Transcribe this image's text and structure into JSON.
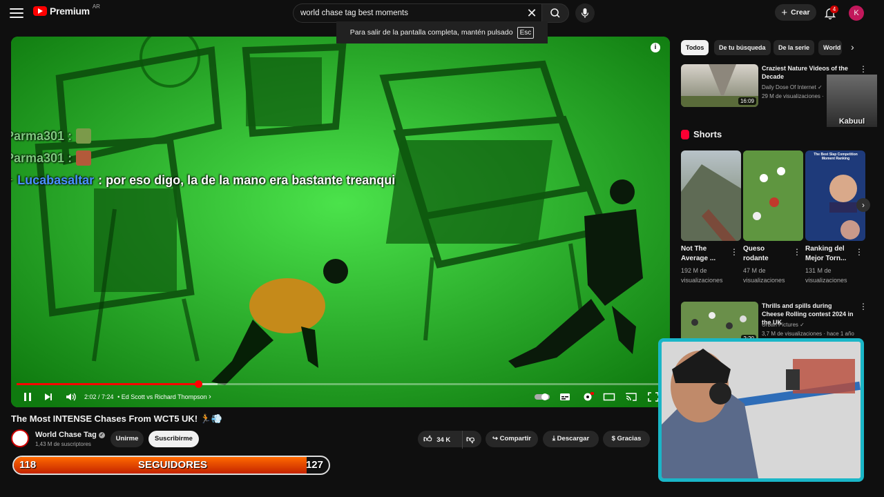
{
  "header": {
    "logo_text": "Premium",
    "logo_country": "AR",
    "search_value": "world chase tag best moments",
    "create_label": "Crear",
    "notification_count": "4",
    "avatar_letter": "K"
  },
  "fullscreen_toast": {
    "text": "Para salir de la pantalla completa, mantén pulsado",
    "key": "Esc"
  },
  "player": {
    "chat": [
      {
        "user": "Parma301 :",
        "message": ""
      },
      {
        "user": "Parma301 :",
        "message": ""
      },
      {
        "user": "Lucabasaltar",
        "message": ": por eso digo, la de la mano era bastante treanqui"
      }
    ],
    "time_display": "2:02 / 7:24",
    "chapter": "• Ed Scott vs Richard Thompson",
    "progress_fraction": 0.28,
    "buffer_fraction": 0.31
  },
  "video": {
    "title": "The Most INTENSE Chases From WCT5 UK! 🏃💨",
    "channel_name": "World Chase Tag",
    "subscribers": "1,43 M de suscriptores",
    "join_label": "Unirme",
    "subscribe_label": "Suscribirme",
    "likes": "34 K",
    "share_label": "Compartir",
    "download_label": "Descargar",
    "thanks_label": "Gracias"
  },
  "followers_goal": {
    "current": "118",
    "label": "SEGUIDORES",
    "target": "127",
    "fraction": 0.929
  },
  "sidebar": {
    "chips": [
      "Todos",
      "De tu búsqueda",
      "De la serie",
      "World"
    ],
    "recommended": [
      {
        "title": "Craziest Nature Videos of the Decade",
        "channel": "Daily Dose Of Internet",
        "views": "29 M de visualizaciones ·",
        "duration": "16:09"
      },
      {
        "title": "Thrills and spills during Cheese Rolling contest 2024 in the UK",
        "channel": "Urban Pictures",
        "views": "3,7 M de visualizaciones · hace 1 año",
        "duration": "2:20"
      }
    ],
    "overlay_label": "Kabuul",
    "shorts_heading": "Shorts",
    "shorts": [
      {
        "title": "Not The Average ...",
        "views": "192 M de visualizaciones"
      },
      {
        "title": "Queso rodante",
        "views": "47 M de visualizaciones"
      },
      {
        "title": "Ranking del Mejor Torn...",
        "views": "131 M de visualizaciones"
      }
    ],
    "short_thumb_caption": "The Best Slap Competition Moment Ranking"
  },
  "colors": {
    "accent": "#ff0000",
    "webcam_border": "#1ab6c7",
    "follow_bar": "#e04a00"
  }
}
